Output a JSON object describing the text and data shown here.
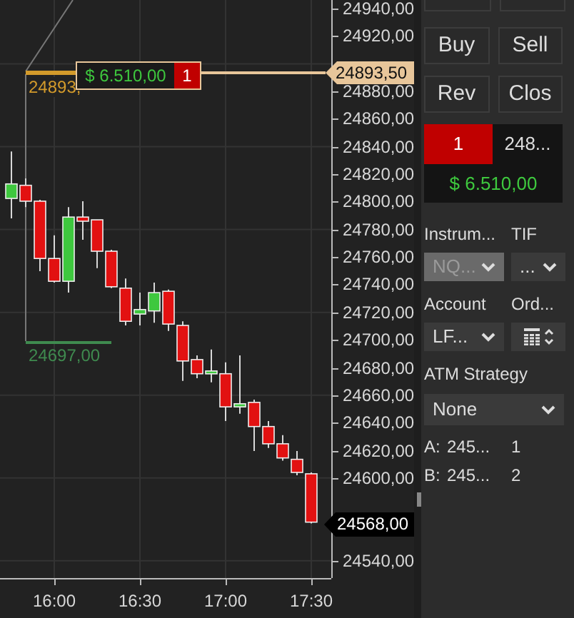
{
  "chart": {
    "chart_data": {
      "type": "candlestick",
      "x": [
        945,
        950,
        955,
        960,
        965,
        970,
        975,
        980,
        985,
        990,
        995,
        1000,
        1005,
        1010,
        1015,
        1020,
        1025,
        1030,
        1035,
        1040,
        1045,
        1050
      ],
      "ohlc": [
        [
          24802.5,
          24836.5,
          24788,
          24813
        ],
        [
          24812,
          24817,
          24796.25,
          24800.5
        ],
        [
          24800.5,
          24801.5,
          24749.75,
          24759
        ],
        [
          24759,
          24775.75,
          24741.5,
          24742.5
        ],
        [
          24742.5,
          24796.25,
          24734.25,
          24789
        ],
        [
          24789,
          24800.5,
          24772.5,
          24786
        ],
        [
          24787,
          24787,
          24752,
          24764.25
        ],
        [
          24764.25,
          24765.25,
          24737.5,
          24738.5
        ],
        [
          24737.5,
          24744.5,
          24710.5,
          24713.5
        ],
        [
          24718.75,
          24734.25,
          24710.5,
          24722
        ],
        [
          24721,
          24741.5,
          24712.5,
          24734.25
        ],
        [
          24735.25,
          24736.5,
          24706.5,
          24711.5
        ],
        [
          24710.5,
          24713.5,
          24670.25,
          24684.75
        ],
        [
          24685.75,
          24688.75,
          24672.25,
          24675.5
        ],
        [
          24675.5,
          24693,
          24669.25,
          24677.5
        ],
        [
          24675.5,
          24683.75,
          24641.25,
          24651.5
        ],
        [
          24651.5,
          24688.75,
          24646.5,
          24653.75
        ],
        [
          24654.75,
          24656.75,
          24619.5,
          24637.25
        ],
        [
          24637.25,
          24641.25,
          24621.75,
          24624.75
        ],
        [
          24624.75,
          24631,
          24612.5,
          24614.5
        ],
        [
          24613.5,
          24619.5,
          24602,
          24604
        ],
        [
          24603,
          24604,
          24567,
          24568
        ]
      ],
      "xlim": [
        941,
        1057
      ],
      "ylim": [
        24527.5,
        24946.25
      ],
      "grid": true,
      "yticks": [
        {
          "value": 24940,
          "label": "24940,00"
        },
        {
          "value": 24920,
          "label": "24920,00"
        },
        {
          "value": 24880,
          "label": "24880,00"
        },
        {
          "value": 24860,
          "label": "24860,00"
        },
        {
          "value": 24840,
          "label": "24840,00"
        },
        {
          "value": 24820,
          "label": "24820,00"
        },
        {
          "value": 24800,
          "label": "24800,00"
        },
        {
          "value": 24780,
          "label": "24780,00"
        },
        {
          "value": 24760,
          "label": "24760,00"
        },
        {
          "value": 24740,
          "label": "24740,00"
        },
        {
          "value": 24720,
          "label": "24720,00"
        },
        {
          "value": 24700,
          "label": "24700,00"
        },
        {
          "value": 24680,
          "label": "24680,00"
        },
        {
          "value": 24660,
          "label": "24660,00"
        },
        {
          "value": 24640,
          "label": "24640,00"
        },
        {
          "value": 24620,
          "label": "24620,00"
        },
        {
          "value": 24600,
          "label": "24600,00"
        },
        {
          "value": 24540,
          "label": "24540,00"
        }
      ],
      "xticks": [
        {
          "value": 960,
          "label": "16:00"
        },
        {
          "value": 990,
          "label": "16:30"
        },
        {
          "value": 1020,
          "label": "17:00"
        },
        {
          "value": 1050,
          "label": "17:30"
        }
      ]
    },
    "position_flag": {
      "pnl": "$ 6.510,00",
      "quantity": "1"
    },
    "entry_label": "24893,",
    "entry_marker": "24893,50",
    "stop_label": "24697,00",
    "last_price": "24568,00"
  },
  "order_panel": {
    "buttons": [
      {
        "label": "Buy"
      },
      {
        "label": "Sell"
      },
      {
        "label": "Rev"
      },
      {
        "label": "Clos"
      }
    ],
    "position": {
      "quantity": "1",
      "price": "248...",
      "pnl": "$ 6.510,00"
    },
    "instrument": {
      "label": "Instrum...",
      "value": "NQ...",
      "disabled": true
    },
    "tif": {
      "label": "TIF",
      "value": "..."
    },
    "account": {
      "label": "Account",
      "value": "LF..."
    },
    "order_qty": {
      "label": "Ord..."
    },
    "atm_strategy": {
      "label": "ATM Strategy",
      "value": "None"
    },
    "brackets": [
      {
        "name": "A:",
        "price": "245...",
        "qty": "1"
      },
      {
        "name": "B:",
        "price": "245...",
        "qty": "2"
      }
    ]
  }
}
